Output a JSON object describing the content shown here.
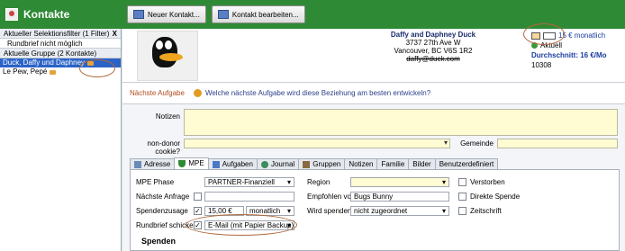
{
  "app": {
    "title": "Kontakte"
  },
  "toolbar": {
    "new_contact": "Neuer Kontakt...",
    "edit_contact": "Kontakt bearbeiten..."
  },
  "left": {
    "filter_header": "Aktueller Selektionsfilter (1 Filter)",
    "filter_close": "X",
    "filter_item": "Rundbrief nicht möglich",
    "group_header": "Aktuelle Gruppe (2 Kontakte)",
    "contacts": [
      "Duck, Daffy und Daphney",
      "Le Pew, Pepé"
    ]
  },
  "contact": {
    "name": "Daffy and Daphney Duck",
    "street": "3737 27th Ave W",
    "city": "Vancouver, BC  V6S 1R2",
    "email": "daffy@duck.com",
    "monthly": "15 € monatlich",
    "status": "Aktuell",
    "average": "Durchschnitt: 16 €/Mo",
    "id": "10308"
  },
  "next_task": {
    "label": "Nächste Aufgabe",
    "question": "Welche nächste Aufgabe wird diese Beziehung am besten entwickeln?"
  },
  "fields": {
    "notes_label": "Notizen",
    "cookie_label": "non-donor cookie?",
    "region_label": "Region",
    "community_label": "Gemeinde"
  },
  "tabs": [
    "Adresse",
    "MPE",
    "Aufgaben",
    "Journal",
    "Gruppen",
    "Notizen",
    "Familie",
    "Bilder",
    "Benutzerdefiniert"
  ],
  "mpe": {
    "phase_label": "MPE Phase",
    "phase_value": "PARTNER-Finanziell",
    "next_request_label": "Nächste Anfrage",
    "pledge_label": "Spendenzusage",
    "pledge_amount": "15,00 €",
    "pledge_freq": "monatlich",
    "newsletter_label": "Rundbrief schicken",
    "newsletter_value": "E-Mail (mit Papier Backup)",
    "region_label": "Region",
    "referred_label": "Empfohlen von",
    "referred_value": "Bugs Bunny",
    "will_donate_label": "Wird spenden?",
    "will_donate_value": "nicht zugeordnet",
    "deceased_label": "Verstorben",
    "direct_label": "Direkte Spende",
    "magazine_label": "Zeitschrift",
    "donations_label": "Spenden"
  }
}
